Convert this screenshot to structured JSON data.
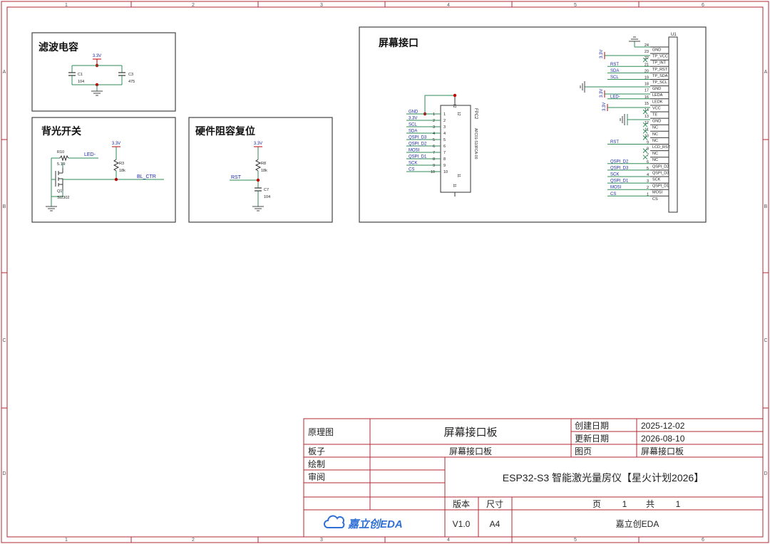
{
  "frame": {
    "col_labels": [
      "1",
      "2",
      "3",
      "4",
      "5",
      "6"
    ],
    "row_labels": [
      "A",
      "B",
      "C",
      "D"
    ]
  },
  "colors": {
    "border": "#b02a30",
    "wire": "#2e8b57",
    "net": "#1a2aa8",
    "junction": "#c00000",
    "text": "#222222"
  },
  "filter_block": {
    "title": "滤波电容",
    "net": "3.3V",
    "c1_ref": "C1",
    "c1_val": "104",
    "c3_ref": "C3",
    "c3_val": "475"
  },
  "backlight_block": {
    "title": "背光开关",
    "r10_ref": "R10",
    "r10_val": "5.1R",
    "led_net": "LED-",
    "supply": "3.3V",
    "r3_ref": "R3",
    "r3_val": "18k",
    "q1_ref": "Q1",
    "q1_val": "SI2302",
    "ctrl_net": "BL_CTR"
  },
  "reset_block": {
    "title": "硬件阻容复位",
    "supply": "3.3V",
    "r8_ref": "R8",
    "r8_val": "18k",
    "rst_net": "RST",
    "c7_ref": "C7",
    "c7_val": "104"
  },
  "screen_block": {
    "title": "屏幕接口",
    "fpc_ref": "FPC2",
    "fpc_part": "AFC01-S10FCA-00",
    "fpc_pins": [
      {
        "net": "GND",
        "num": "1"
      },
      {
        "net": "3.3V",
        "num": "2"
      },
      {
        "net": "SCL",
        "num": "3"
      },
      {
        "net": "SDA",
        "num": "4"
      },
      {
        "net": "QSPI_D3",
        "num": "5"
      },
      {
        "net": "QSPI_D2",
        "num": "6"
      },
      {
        "net": "MOSI",
        "num": "7"
      },
      {
        "net": "QSPI_D1",
        "num": "8"
      },
      {
        "net": "SCK",
        "num": "9"
      },
      {
        "net": "CS",
        "num": "10"
      }
    ],
    "fpc_top_pin": "12",
    "fpc_side_pin": "12",
    "fpc_bottom_pin": "11",
    "fpc_bottom_pin2": "11",
    "u1_ref": "U1",
    "u1_pins": [
      {
        "num": "24",
        "name": "GND",
        "net": ""
      },
      {
        "num": "23",
        "name": "TP_VCC",
        "net": ""
      },
      {
        "num": "22",
        "name": "TP_INT",
        "net": ""
      },
      {
        "num": "21",
        "name": "TP_RST",
        "net": "RST"
      },
      {
        "num": "20",
        "name": "TP_SDA",
        "net": "SDA"
      },
      {
        "num": "19",
        "name": "TP_SCL",
        "net": "SCL"
      },
      {
        "num": "18",
        "name": "GND",
        "net": ""
      },
      {
        "num": "17",
        "name": "LEDA",
        "net": ""
      },
      {
        "num": "16",
        "name": "LEDK",
        "net": "LED-"
      },
      {
        "num": "15",
        "name": "VCC",
        "net": ""
      },
      {
        "num": "14",
        "name": "TE",
        "net": ""
      },
      {
        "num": "13",
        "name": "GND",
        "net": ""
      },
      {
        "num": "12",
        "name": "NC",
        "net": ""
      },
      {
        "num": "11",
        "name": "NC",
        "net": ""
      },
      {
        "num": "10",
        "name": "NC",
        "net": ""
      },
      {
        "num": "9",
        "name": "LCD_RST",
        "net": "RST"
      },
      {
        "num": "8",
        "name": "NC",
        "net": ""
      },
      {
        "num": "7",
        "name": "NC",
        "net": ""
      },
      {
        "num": "6",
        "name": "QSPI_D2",
        "net": "QSPI_D2"
      },
      {
        "num": "5",
        "name": "QSPI_D3",
        "net": "QSPI_D3"
      },
      {
        "num": "4",
        "name": "SCK",
        "net": "SCK"
      },
      {
        "num": "3",
        "name": "QSPI_D1",
        "net": "QSPI_D1"
      },
      {
        "num": "2",
        "name": "MOSI",
        "net": "MOSI"
      },
      {
        "num": "1",
        "name": "CS",
        "net": "CS"
      }
    ],
    "vcc_labels": [
      "3.3V",
      "3.3V",
      "3.3V"
    ]
  },
  "title_block": {
    "label_schematic": "原理图",
    "schematic_name": "屏幕接口板",
    "label_created": "创建日期",
    "created": "2025-12-02",
    "label_updated": "更新日期",
    "updated": "2026-08-10",
    "label_board": "板子",
    "board": "屏幕接口板",
    "label_page": "图页",
    "page_name": "屏幕接口板",
    "label_drawn": "绘制",
    "label_review": "审阅",
    "project": "ESP32-S3 智能激光量房仪【星火计划2026】",
    "label_version": "版本",
    "label_size": "尺寸",
    "version": "V1.0",
    "size": "A4",
    "label_page_word": "页",
    "page_num": "1",
    "label_total_word": "共",
    "page_total": "1",
    "logo_text": "嘉立创EDA",
    "company": "嘉立创EDA"
  }
}
